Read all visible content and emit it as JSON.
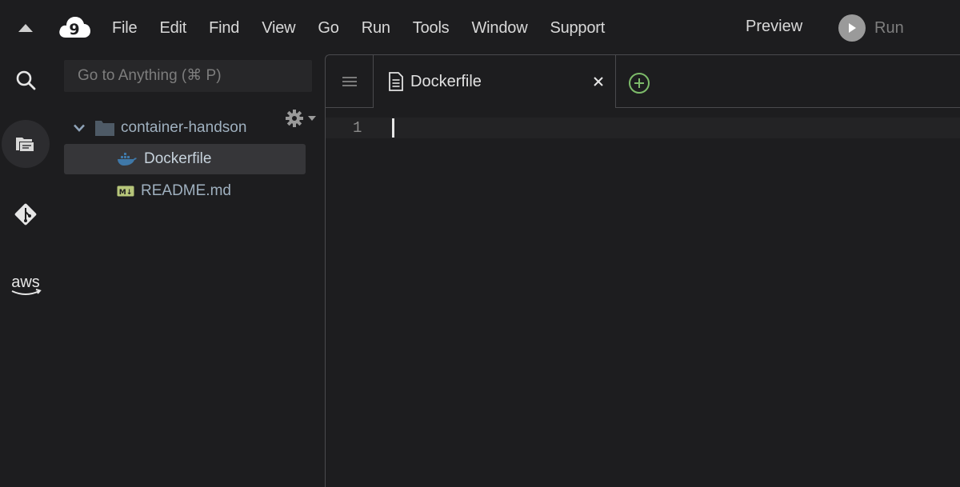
{
  "menubar": {
    "items": [
      {
        "label": "File"
      },
      {
        "label": "Edit"
      },
      {
        "label": "Find"
      },
      {
        "label": "View"
      },
      {
        "label": "Go"
      },
      {
        "label": "Run"
      },
      {
        "label": "Tools"
      },
      {
        "label": "Window"
      },
      {
        "label": "Support"
      }
    ],
    "preview_label": "Preview",
    "run_label": "Run",
    "logo_text": "9"
  },
  "rail": {
    "items": [
      {
        "name": "search-icon"
      },
      {
        "name": "files-icon"
      },
      {
        "name": "git-icon"
      },
      {
        "name": "aws-icon",
        "label": "aws"
      }
    ]
  },
  "tree": {
    "goto_placeholder": "Go to Anything (⌘ P)",
    "root": {
      "label": "container-handson"
    },
    "files": [
      {
        "label": "Dockerfile",
        "icon": "docker-icon",
        "selected": true
      },
      {
        "label": "README.md",
        "icon": "markdown-icon",
        "badge": "M↓"
      }
    ]
  },
  "editor": {
    "tab": {
      "label": "Dockerfile"
    },
    "line_numbers": [
      "1"
    ]
  },
  "colors": {
    "background": "#1d1d1f",
    "panel_border": "#4a4a4d",
    "new_tab_green": "#7dbb6a",
    "folder_grey": "#4e5a66"
  }
}
